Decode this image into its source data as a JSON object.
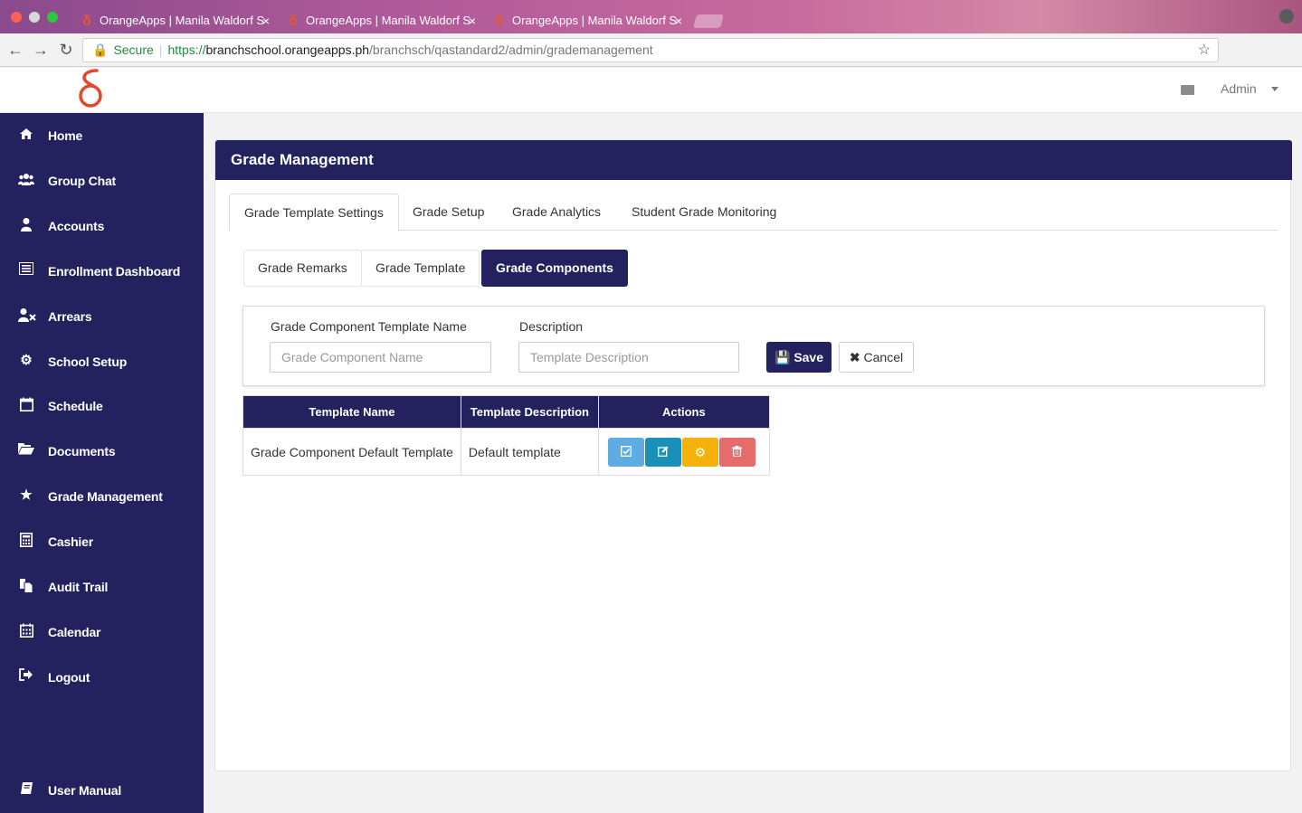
{
  "browser": {
    "tabs": [
      {
        "title": "OrangeApps | Manila Waldorf S"
      },
      {
        "title": "OrangeApps | Manila Waldorf S"
      },
      {
        "title": "OrangeApps | Manila Waldorf S"
      }
    ],
    "address": {
      "secure_label": "Secure",
      "scheme": "https://",
      "host": "branchschool.orangeapps.ph",
      "path": "/branchsch/qastandard2/admin/grademanagement"
    }
  },
  "header": {
    "user_label": "Admin"
  },
  "sidebar": {
    "items": [
      {
        "label": "Home",
        "icon": "home-icon"
      },
      {
        "label": "Group Chat",
        "icon": "users-icon"
      },
      {
        "label": "Accounts",
        "icon": "user-icon"
      },
      {
        "label": "Enrollment Dashboard",
        "icon": "list-icon"
      },
      {
        "label": "Arrears",
        "icon": "user-times-icon"
      },
      {
        "label": "School Setup",
        "icon": "gear-icon"
      },
      {
        "label": "Schedule",
        "icon": "calendar-icon"
      },
      {
        "label": "Documents",
        "icon": "folder-open-icon"
      },
      {
        "label": "Grade Management",
        "icon": "star-icon"
      },
      {
        "label": "Cashier",
        "icon": "calculator-icon"
      },
      {
        "label": "Audit Trail",
        "icon": "files-icon"
      },
      {
        "label": "Calendar",
        "icon": "calendar-grid-icon"
      },
      {
        "label": "Logout",
        "icon": "sign-out-icon"
      },
      {
        "label": "User Manual",
        "icon": "book-icon"
      }
    ]
  },
  "main": {
    "title": "Grade Management",
    "tabs": [
      {
        "label": "Grade Template Settings"
      },
      {
        "label": "Grade Setup"
      },
      {
        "label": "Grade Analytics"
      },
      {
        "label": "Student Grade Monitoring"
      }
    ],
    "subtabs": [
      {
        "label": "Grade Remarks"
      },
      {
        "label": "Grade Template"
      },
      {
        "label": "Grade Components"
      }
    ],
    "form": {
      "name_label": "Grade Component Template Name",
      "name_placeholder": "Grade Component Name",
      "name_value": "",
      "desc_label": "Description",
      "desc_placeholder": "Template Description",
      "desc_value": "",
      "save_label": "Save",
      "cancel_label": "Cancel"
    },
    "table": {
      "headers": [
        "Template Name",
        "Template Description",
        "Actions"
      ],
      "rows": [
        {
          "name": "Grade Component Default Template",
          "description": "Default template"
        }
      ],
      "action_colors": [
        "#5dade2",
        "#1a8fb8",
        "#f5b10a",
        "#e86b6b"
      ]
    }
  }
}
